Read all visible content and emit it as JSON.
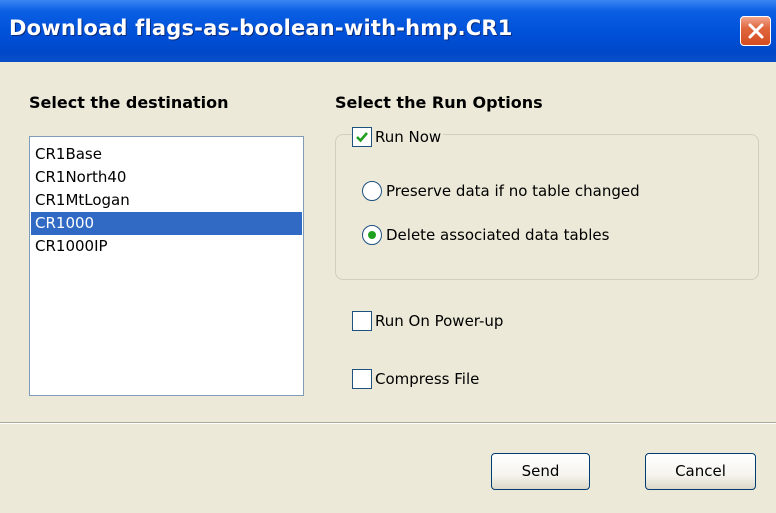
{
  "window": {
    "title": "Download flags-as-boolean-with-hmp.CR1",
    "close_icon": "close-icon"
  },
  "destination": {
    "heading": "Select the destination",
    "items": [
      "CR1Base",
      "CR1North40",
      "CR1MtLogan",
      "CR1000",
      "CR1000IP"
    ],
    "selected": "CR1000"
  },
  "run_options": {
    "heading": "Select the Run Options",
    "run_now": {
      "label": "Run Now",
      "checked": true
    },
    "preserve": {
      "label": "Preserve data if no table changed",
      "selected": false
    },
    "delete": {
      "label": "Delete associated data tables",
      "selected": true
    },
    "run_on_powerup": {
      "label": "Run On Power-up",
      "checked": false
    },
    "compress_file": {
      "label": "Compress File",
      "checked": false
    }
  },
  "buttons": {
    "send": "Send",
    "cancel": "Cancel"
  },
  "colors": {
    "titlebar": "#0050d8",
    "close": "#d44c20",
    "selection": "#316ac5",
    "dialog_bg": "#ece9d8",
    "check_mark": "#21a121"
  }
}
